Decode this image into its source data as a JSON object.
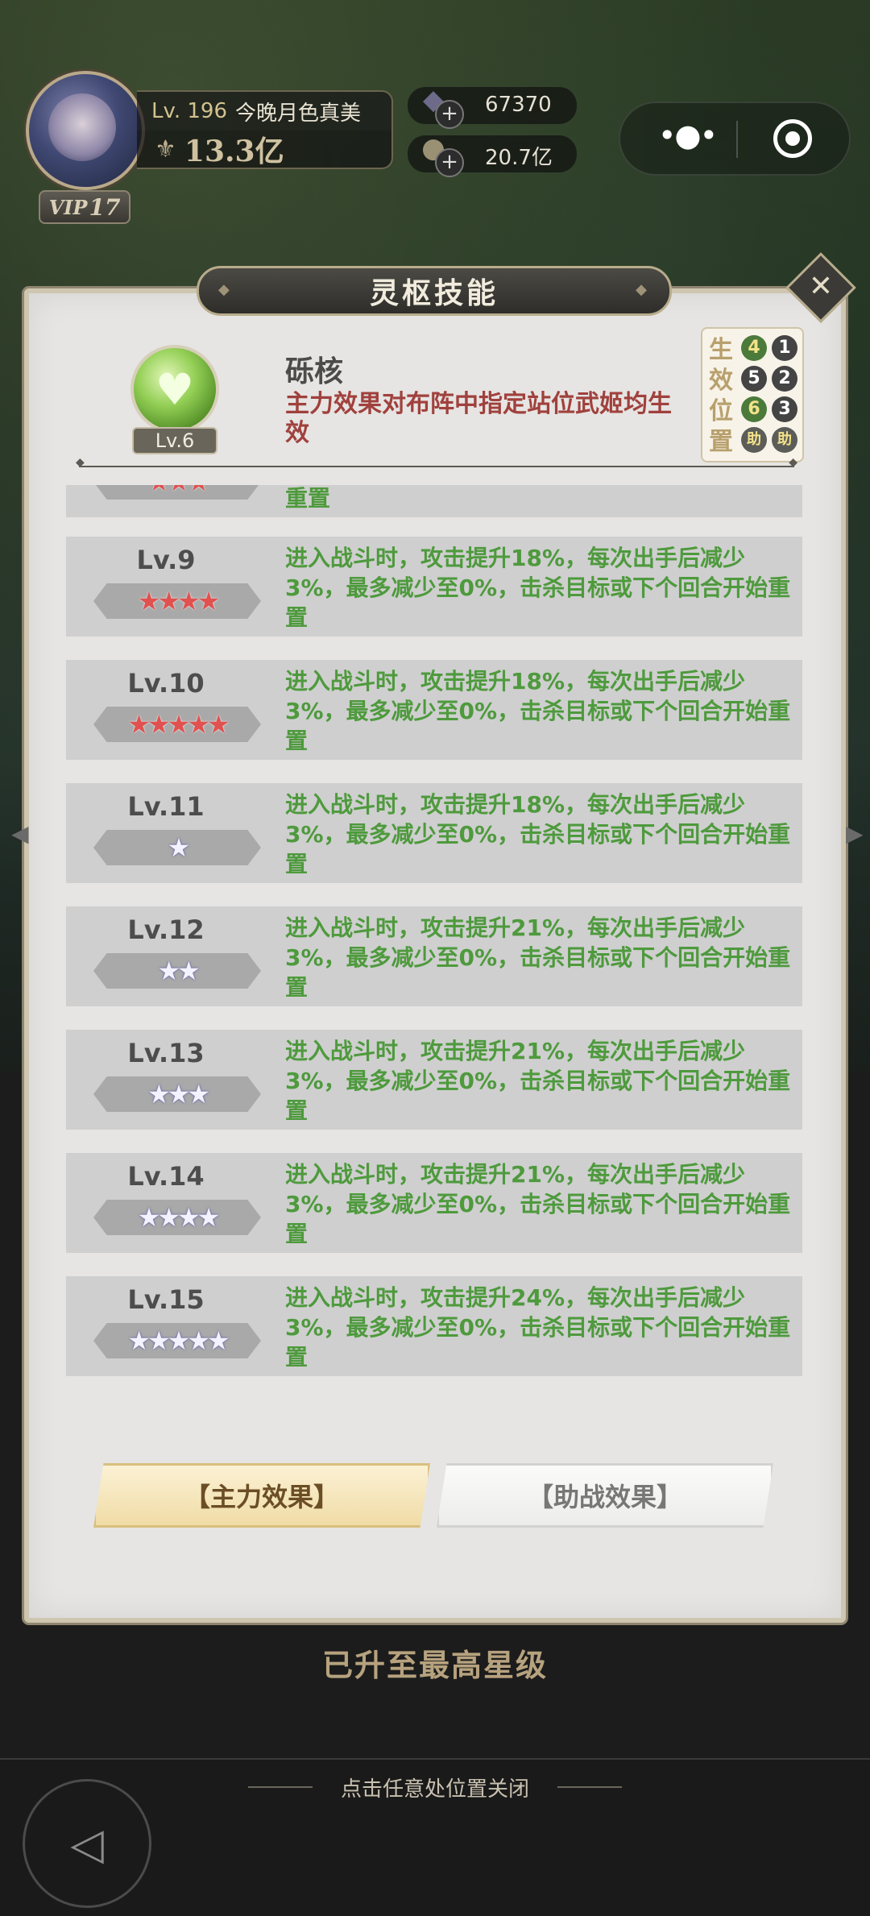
{
  "player": {
    "level_prefix": "Lv. 196",
    "name": "今晚月色真美",
    "vip_label": "VIP",
    "vip_level": "17",
    "power": "13.3亿"
  },
  "resources": [
    {
      "icon": "gem-icon",
      "amount": "67370"
    },
    {
      "icon": "coin-icon",
      "amount": "20.7亿"
    }
  ],
  "dialog": {
    "title": "灵枢技能",
    "skill": {
      "name": "砾核",
      "level": "Lv.6",
      "description": "主力效果对布阵中指定站位武姬均生效"
    },
    "positions": {
      "label": "生效位置",
      "grid": [
        "4",
        "1",
        "5",
        "2",
        "6",
        "3",
        "助",
        "助"
      ]
    },
    "partial_row_text": "重置",
    "levels": [
      {
        "level": "Lv.9",
        "stars": "★★★★",
        "star_color": "red",
        "desc": "进入战斗时，攻击提升18%，每次出手后减少3%，最多减少至0%，击杀目标或下个回合开始重置"
      },
      {
        "level": "Lv.10",
        "stars": "★★★★★",
        "star_color": "red",
        "desc": "进入战斗时，攻击提升18%，每次出手后减少3%，最多减少至0%，击杀目标或下个回合开始重置"
      },
      {
        "level": "Lv.11",
        "stars": "★",
        "star_color": "white",
        "desc": "进入战斗时，攻击提升18%，每次出手后减少3%，最多减少至0%，击杀目标或下个回合开始重置"
      },
      {
        "level": "Lv.12",
        "stars": "★★",
        "star_color": "white",
        "desc": "进入战斗时，攻击提升21%，每次出手后减少3%，最多减少至0%，击杀目标或下个回合开始重置"
      },
      {
        "level": "Lv.13",
        "stars": "★★★",
        "star_color": "white",
        "desc": "进入战斗时，攻击提升21%，每次出手后减少3%，最多减少至0%，击杀目标或下个回合开始重置"
      },
      {
        "level": "Lv.14",
        "stars": "★★★★",
        "star_color": "white",
        "desc": "进入战斗时，攻击提升21%，每次出手后减少3%，最多减少至0%，击杀目标或下个回合开始重置"
      },
      {
        "level": "Lv.15",
        "stars": "★★★★★",
        "star_color": "white",
        "desc": "进入战斗时，攻击提升24%，每次出手后减少3%，最多减少至0%，击杀目标或下个回合开始重置"
      }
    ],
    "tabs": {
      "main": "【主力效果】",
      "assist": "【助战效果】"
    }
  },
  "max_star_message": "已升至最高星级",
  "close_hint": "点击任意处位置关闭"
}
